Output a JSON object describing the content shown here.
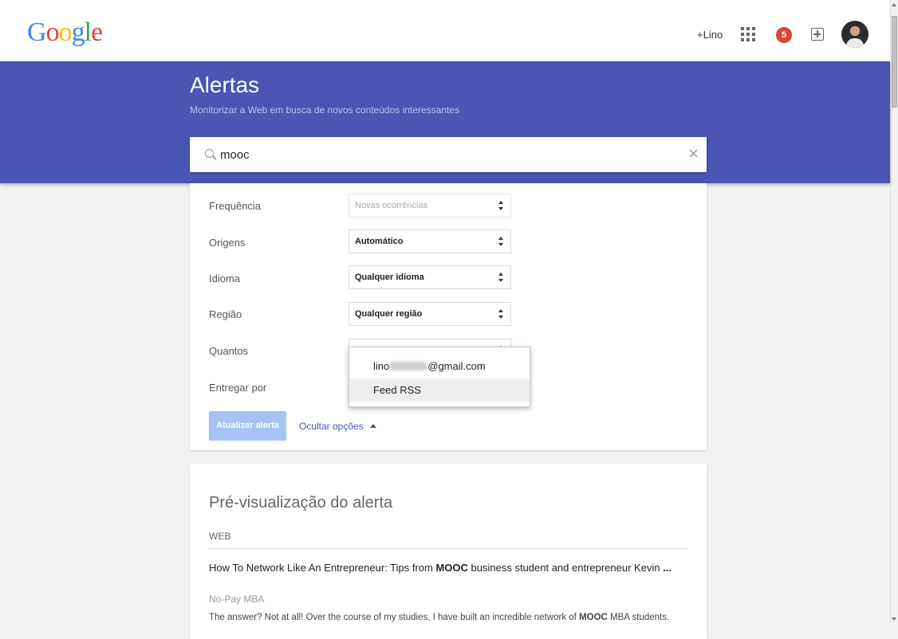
{
  "header": {
    "logo": [
      "G",
      "o",
      "o",
      "g",
      "l",
      "e"
    ],
    "user_link": "+Lino",
    "notifications_count": "5"
  },
  "hero": {
    "title": "Alertas",
    "subtitle": "Monitorizar a Web em busca de novos conteúdos interessantes",
    "search_value": "mooc"
  },
  "options": {
    "rows": [
      {
        "label": "Frequência",
        "value": "Novas ocorrências"
      },
      {
        "label": "Origens",
        "value": "Automático"
      },
      {
        "label": "Idioma",
        "value": "Qualquer idioma"
      },
      {
        "label": "Região",
        "value": "Qualquer região"
      },
      {
        "label": "Quantos",
        "value": ""
      },
      {
        "label": "Entregar por",
        "value": ""
      }
    ],
    "deliver_dropdown": {
      "email_prefix": "lino",
      "email_suffix": "@gmail.com",
      "rss": "Feed RSS"
    },
    "update_button": "Atualizar alerta",
    "hide_options": "Ocultar opções"
  },
  "preview": {
    "title": "Pré-visualização do alerta",
    "section": "WEB",
    "result": {
      "title_part1": "How To Network Like An Entrepreneur: Tips from ",
      "title_bold1": "MOOC",
      "title_part2": " business student and entrepreneur Kevin ",
      "title_bold2": "...",
      "source": "No-Pay MBA",
      "snippet_part1": "The answer? Not at all! Over the course of my studies, I have built an incredible network of ",
      "snippet_bold": "MOOC",
      "snippet_part2": " MBA students."
    }
  }
}
